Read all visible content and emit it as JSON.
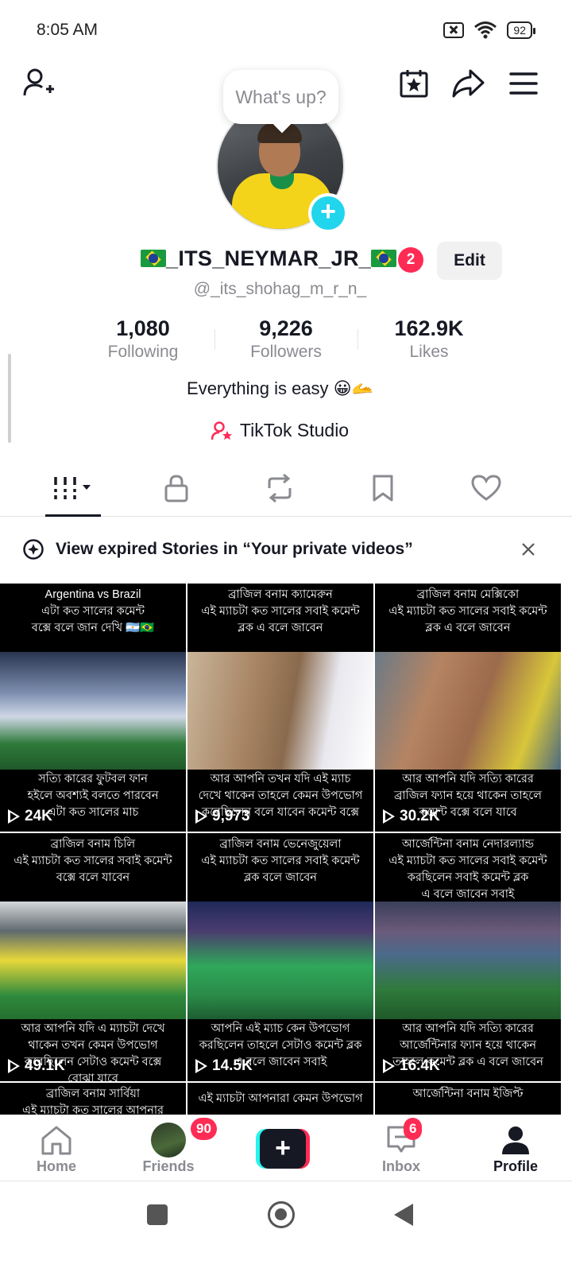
{
  "status_bar": {
    "time": "8:05 AM",
    "battery": "92"
  },
  "tooltip": {
    "text": "What's up?"
  },
  "profile": {
    "display_name": "_ITS_NEYMAR_JR_",
    "notification_count": "2",
    "edit_label": "Edit",
    "username": "@_its_shohag_m_r_n_",
    "stats": [
      {
        "value": "1,080",
        "label": "Following"
      },
      {
        "value": "9,226",
        "label": "Followers"
      },
      {
        "value": "162.9K",
        "label": "Likes"
      }
    ],
    "bio": "Everything is easy 😀🫴",
    "studio_label": "TikTok Studio"
  },
  "tabs": [
    {
      "name": "videos",
      "icon": "grid-icon"
    },
    {
      "name": "private",
      "icon": "lock-icon"
    },
    {
      "name": "reposts",
      "icon": "repost-icon"
    },
    {
      "name": "favorites",
      "icon": "bookmark-icon"
    },
    {
      "name": "liked",
      "icon": "heart-icon"
    }
  ],
  "stories_banner": {
    "text": "View expired Stories in “Your private videos”"
  },
  "videos": [
    {
      "caption_top": "Argentina vs Brazil\nএটা কত সালের কমেন্ট\nবক্সে বলে জান দেখি 🇦🇷🇧🇷",
      "caption_bottom": "সত্যি কারের ফুটবল ফান\nহইলে অবশ্যই বলতে পারবেন\nএটা কত সালের মাচ",
      "views": "24K"
    },
    {
      "caption_top": "ব্রাজিল বনাম ক্যামেরুন\nএই ম্যাচটা কত সালের সবাই কমেন্ট\nব্লক এ বলে জাবেন",
      "caption_bottom": "আর আপনি তখন যদি এই ম্যাচ\nদেখে থাকেন তাহলে কেমন উপভোগ\nকরেছিলেন বলে যাবেন কমেন্ট বক্সে",
      "views": "9,973"
    },
    {
      "caption_top": "ব্রাজিল বনাম মেক্সিকো\nএই ম্যাচটা কত সালের সবাই কমেন্ট\nব্লক এ বলে জাবেন",
      "caption_bottom": "আর আপনি যদি সত্যি কারের\nব্রাজিল ফ্যান হয়ে থাকেন তাহলে\nকমেন্ট বক্সে বলে যাবে",
      "views": "30.2K"
    },
    {
      "caption_top": "ব্রাজিল বনাম চিলি\nএই ম্যাচটা কত সালের সবাই কমেন্ট\nবক্সে বলে যাবেন",
      "caption_bottom": "আর আপনি যদি এ ম্যাচটা দেখে\nথাকেন তখন কেমন উপভোগ\nকরেছিলেন সেটাও কমেন্ট বক্সে\nবোঝা যাবে",
      "views": "49.1K"
    },
    {
      "caption_top": "ব্রাজিল বনাম ভেনেজুয়েলা\nএই ম্যাচটা কত সালের সবাই কমেন্ট\nব্লক বলে জাবেন",
      "caption_bottom": "আপনি এই ম্যাচ কেন উপভোগ\nকরছিলেন তাহলে সেটাও কমেন্ট ব্লক\nএ বলে জাবেন সবাই",
      "views": "14.5K"
    },
    {
      "caption_top": "আর্জেন্টিনা বনাম নেদারল্যান্ড\nএই ম্যাচটা কত সালের সবাই কমেন্ট\nকরছিলেন সবাই কমেন্ট ব্লক\nএ বলে জাবেন সবাই",
      "caption_bottom": "আর আপনি যদি সত্যি কারের\nআর্জেন্টিনার ফ্যান হয়ে থাকেন\nতাহলে কমেন্ট ব্লক এ বলে জাবেন",
      "views": "16.4K"
    }
  ],
  "videos_partial": [
    {
      "caption_top": "ব্রাজিল বনাম সার্বিয়া\nএই ম্যাচটা কত সালের আপনার"
    },
    {
      "caption_top": "এই ম্যাচটা আপনারা কেমন উপভোগ"
    },
    {
      "caption_top": "আর্জেন্টিনা বনাম ইজিপ্ট"
    }
  ],
  "bottom_nav": {
    "home": "Home",
    "friends": "Friends",
    "friends_badge": "90",
    "inbox": "Inbox",
    "inbox_badge": "6",
    "profile": "Profile"
  },
  "colors": {
    "accent": "#fe2c55",
    "cyan": "#25f4ee",
    "text": "#161823",
    "muted": "#8a8b91"
  }
}
